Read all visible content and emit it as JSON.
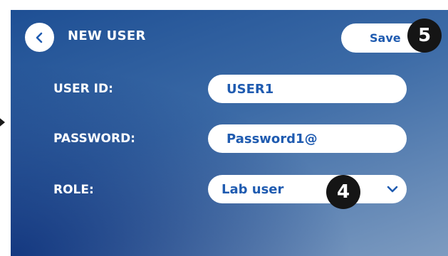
{
  "header": {
    "back_icon": "chevron-left-icon",
    "title": "NEW USER",
    "save_label": "Save"
  },
  "form": {
    "user_id": {
      "label": "USER ID:",
      "value": "USER1"
    },
    "password": {
      "label": "PASSWORD:",
      "value": "Password1@"
    },
    "role": {
      "label": "ROLE:",
      "value": "Lab user",
      "icon": "chevron-down-icon"
    }
  },
  "annotations": {
    "step_5": "5",
    "step_4": "4"
  },
  "colors": {
    "accent": "#1f5bb0",
    "background_dark": "#1e4f94",
    "background_light": "#7d9bc0",
    "badge": "#151515"
  }
}
